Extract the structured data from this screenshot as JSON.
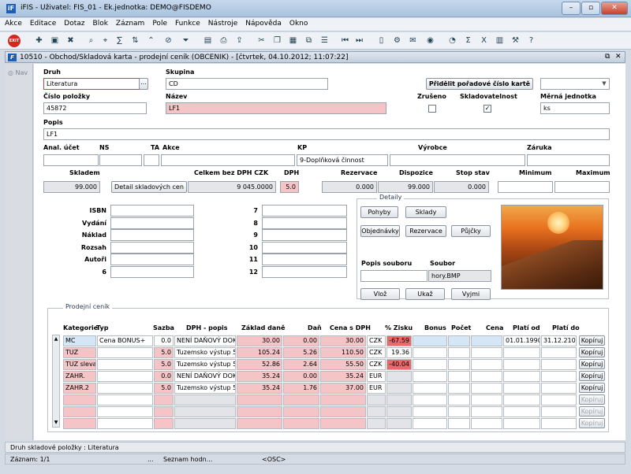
{
  "window": {
    "app_title": "iFIS - Uživatel: FIS_01 - Ek.jednotka: DEMO@FISDEMO",
    "app_icon": "iF"
  },
  "menu": [
    "Akce",
    "Editace",
    "Dotaz",
    "Blok",
    "Záznam",
    "Pole",
    "Funkce",
    "Nástroje",
    "Nápověda",
    "Okno"
  ],
  "toolbar": {
    "exit_label": "EXIT"
  },
  "form": {
    "title": "10510 - Obchod/Skladová karta - prodejní ceník (OBCENIK) - [čtvrtek, 04.10.2012; 11:07:22]",
    "icon": "F"
  },
  "nav": {
    "label": "Nav"
  },
  "fields": {
    "druh": {
      "label": "Druh",
      "value": "Literatura"
    },
    "skupina": {
      "label": "Skupina",
      "value": "CD"
    },
    "assign_button": "Přidělit pořadové číslo kartě",
    "cislo": {
      "label": "Číslo položky",
      "value": "45872"
    },
    "nazev": {
      "label": "Název",
      "value": "LF1"
    },
    "zruseno": {
      "label": "Zrušeno",
      "checked": false
    },
    "skladovatelnost": {
      "label": "Skladovatelnost",
      "checked": true
    },
    "merna": {
      "label": "Měrná jednotka",
      "value": "ks"
    },
    "popis": {
      "label": "Popis",
      "value": "LF1"
    },
    "anal": {
      "label": "Anal. účet",
      "value": ""
    },
    "ns": {
      "label": "NS",
      "value": ""
    },
    "ta": {
      "label": "TA",
      "value": ""
    },
    "akce": {
      "label": "Akce",
      "value": ""
    },
    "kp": {
      "label": "KP",
      "value": "9-Doplňková činnost"
    },
    "vyrobce": {
      "label": "Výrobce",
      "value": ""
    },
    "zaruka": {
      "label": "Záruka",
      "value": ""
    },
    "skladem": {
      "label": "Skladem",
      "value": "99.000"
    },
    "detail_button": "Detail skladových cen",
    "celkem": {
      "label": "Celkem bez DPH CZK",
      "value": "9 045.0000"
    },
    "dph": {
      "label": "DPH",
      "value": "5.0"
    },
    "rezervace": {
      "label": "Rezervace",
      "value": "0.000"
    },
    "dispozice": {
      "label": "Dispozice",
      "value": "99.000"
    },
    "stop": {
      "label": "Stop stav",
      "value": "0.000"
    },
    "minimum": {
      "label": "Minimum",
      "value": ""
    },
    "maximum": {
      "label": "Maximum",
      "value": ""
    }
  },
  "book": {
    "isbn": "ISBN",
    "vydani": "Vydání",
    "naklad": "Náklad",
    "rozsah": "Rozsah",
    "autori": "Autoři",
    "n6": "6",
    "n7": "7",
    "n8": "8",
    "n9": "9",
    "n10": "10",
    "n11": "11",
    "n12": "12"
  },
  "details": {
    "title": "Detaily",
    "pohyby": "Pohyby",
    "sklady": "Sklady",
    "objednavky": "Objednávky",
    "rezervace": "Rezervace",
    "pujcky": "Půjčky",
    "popis_souboru": "Popis souboru",
    "soubor_label": "Soubor",
    "soubor_value": "hory.BMP",
    "vloz": "Vlož",
    "ukaz": "Ukaž",
    "vyjmi": "Vyjmi"
  },
  "pricelist": {
    "title": "Prodejní ceník",
    "headers": {
      "kategorie": "Kategorie",
      "typ": "Typ",
      "sazba": "Sazba",
      "dph_popis": "DPH - popis",
      "zaklad": "Základ daně",
      "dan": "Daň",
      "cena_s_dph": "Cena s DPH",
      "zisk": "% Zisku",
      "bonus": "Bonus",
      "pocet": "Počet",
      "cena": "Cena",
      "platnost_od": "Platí od",
      "platnost_do": "Platí do"
    },
    "copy_label": "Kopíruj",
    "rows": [
      {
        "kategorie": "MC",
        "typ": "Cena BONUS+",
        "sazba": "0.0",
        "dph_popis": "NENÍ DAŇOVÝ DOKL",
        "zaklad": "30.00",
        "dan": "0.00",
        "cena_s_dph": "30.00",
        "mena": "CZK",
        "zisk": "-67.59",
        "od": "01.01.1990",
        "do": "31.12.2100"
      },
      {
        "kategorie": "TUZ",
        "typ": "",
        "sazba": "5.0",
        "dph_popis": "Tuzemsko výstup 5%",
        "zaklad": "105.24",
        "dan": "5.26",
        "cena_s_dph": "110.50",
        "mena": "CZK",
        "zisk": "19.36",
        "od": "",
        "do": ""
      },
      {
        "kategorie": "TUZ sleva",
        "typ": "",
        "sazba": "5.0",
        "dph_popis": "Tuzemsko výstup 5%",
        "zaklad": "52.86",
        "dan": "2.64",
        "cena_s_dph": "55.50",
        "mena": "CZK",
        "zisk": "-40.04",
        "od": "",
        "do": ""
      },
      {
        "kategorie": "ZAHR.",
        "typ": "",
        "sazba": "0.0",
        "dph_popis": "NENÍ DAŇOVÝ DOKL",
        "zaklad": "35.24",
        "dan": "0.00",
        "cena_s_dph": "35.24",
        "mena": "EUR",
        "zisk": "",
        "od": "",
        "do": ""
      },
      {
        "kategorie": "ZAHR.2",
        "typ": "",
        "sazba": "5.0",
        "dph_popis": "Tuzemsko výstup 5%",
        "zaklad": "35.24",
        "dan": "1.76",
        "cena_s_dph": "37.00",
        "mena": "EUR",
        "zisk": "",
        "od": "",
        "do": ""
      }
    ]
  },
  "status": {
    "line1": "Druh skladové položky : Literatura",
    "record": "Záznam: 1/1",
    "dots": "...",
    "list": "Seznam hodn...",
    "osc": "<OSC>"
  }
}
